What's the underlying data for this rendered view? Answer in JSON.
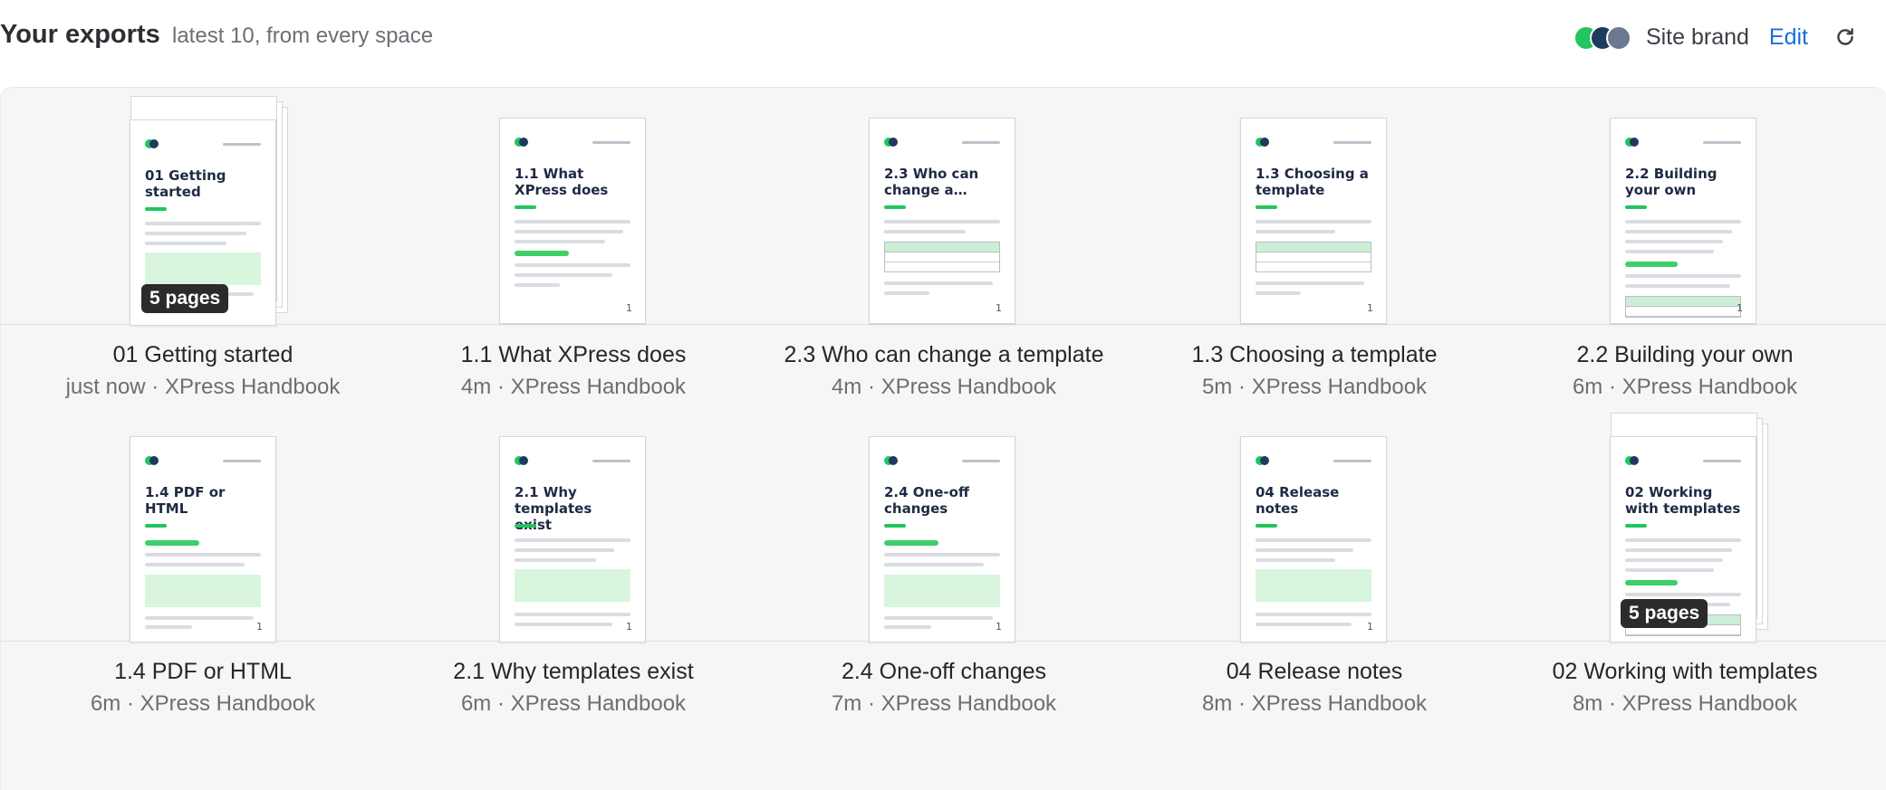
{
  "header": {
    "title": "Your exports",
    "subtitle": "latest 10, from every space",
    "brand_label": "Site brand",
    "edit_label": "Edit",
    "brand_swatches": [
      "#22c55e",
      "#1e3a5f",
      "#6b7a90"
    ],
    "refresh_icon": "refresh-icon"
  },
  "colors": {
    "accent": "#22c55e",
    "doc_title": "#1e2a44",
    "link": "#1a6fd8",
    "badge_bg": "#2b2b2b",
    "panel_bg": "#f6f6f6"
  },
  "exports": [
    {
      "title": "01 Getting started",
      "thumb_title": "01 Getting started",
      "meta": "just now · XPress Handbook",
      "page_number": "",
      "badge": "5 pages"
    },
    {
      "title": "1.1 What XPress does",
      "thumb_title": "1.1 What XPress does",
      "meta": "4m · XPress Handbook",
      "page_number": "1",
      "badge": ""
    },
    {
      "title": "2.3 Who can change a template",
      "thumb_title": "2.3 Who can change a…",
      "meta": "4m · XPress Handbook",
      "page_number": "1",
      "badge": ""
    },
    {
      "title": "1.3 Choosing a template",
      "thumb_title": "1.3 Choosing a template",
      "meta": "5m · XPress Handbook",
      "page_number": "1",
      "badge": ""
    },
    {
      "title": "2.2 Building your own",
      "thumb_title": "2.2 Building your own",
      "meta": "6m · XPress Handbook",
      "page_number": "1",
      "badge": ""
    },
    {
      "title": "1.4 PDF or HTML",
      "thumb_title": "1.4 PDF or HTML",
      "meta": "6m · XPress Handbook",
      "page_number": "1",
      "badge": ""
    },
    {
      "title": "2.1 Why templates exist",
      "thumb_title": "2.1 Why templates exist",
      "meta": "6m · XPress Handbook",
      "page_number": "1",
      "badge": ""
    },
    {
      "title": "2.4 One-off changes",
      "thumb_title": "2.4 One-off changes",
      "meta": "7m · XPress Handbook",
      "page_number": "1",
      "badge": ""
    },
    {
      "title": "04 Release notes",
      "thumb_title": "04 Release notes",
      "meta": "8m · XPress Handbook",
      "page_number": "1",
      "badge": ""
    },
    {
      "title": "02 Working with templates",
      "thumb_title": "02 Working with templates",
      "meta": "8m · XPress Handbook",
      "page_number": "",
      "badge": "5 pages"
    }
  ]
}
